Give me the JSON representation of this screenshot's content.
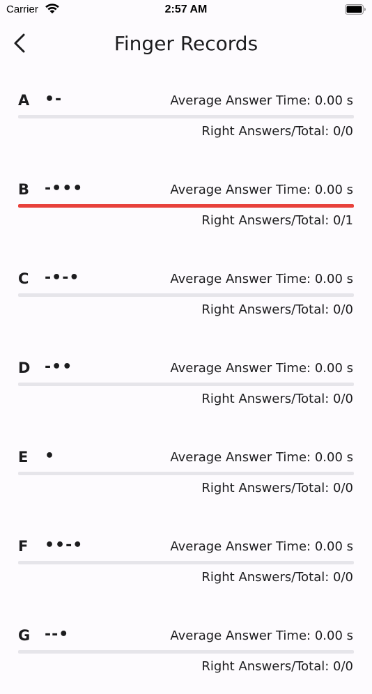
{
  "status_bar": {
    "carrier": "Carrier",
    "time": "2:57 AM"
  },
  "nav": {
    "title": "Finger Records"
  },
  "colors": {
    "bar_track": "#e6e5ea",
    "bar_fill_wrong": "#e8413b"
  },
  "records": [
    {
      "letter": "A",
      "code": "•-",
      "avg": "Average Answer Time: 0.00 s",
      "ratio": "Right Answers/Total: 0/0",
      "wrong_fraction": 0
    },
    {
      "letter": "B",
      "code": "-•••",
      "avg": "Average Answer Time: 0.00 s",
      "ratio": "Right Answers/Total: 0/1",
      "wrong_fraction": 1
    },
    {
      "letter": "C",
      "code": "-•-•",
      "avg": "Average Answer Time: 0.00 s",
      "ratio": "Right Answers/Total: 0/0",
      "wrong_fraction": 0
    },
    {
      "letter": "D",
      "code": "-••",
      "avg": "Average Answer Time: 0.00 s",
      "ratio": "Right Answers/Total: 0/0",
      "wrong_fraction": 0
    },
    {
      "letter": "E",
      "code": "•",
      "avg": "Average Answer Time: 0.00 s",
      "ratio": "Right Answers/Total: 0/0",
      "wrong_fraction": 0
    },
    {
      "letter": "F",
      "code": "••-•",
      "avg": "Average Answer Time: 0.00 s",
      "ratio": "Right Answers/Total: 0/0",
      "wrong_fraction": 0
    },
    {
      "letter": "G",
      "code": "--•",
      "avg": "Average Answer Time: 0.00 s",
      "ratio": "Right Answers/Total: 0/0",
      "wrong_fraction": 0
    }
  ]
}
